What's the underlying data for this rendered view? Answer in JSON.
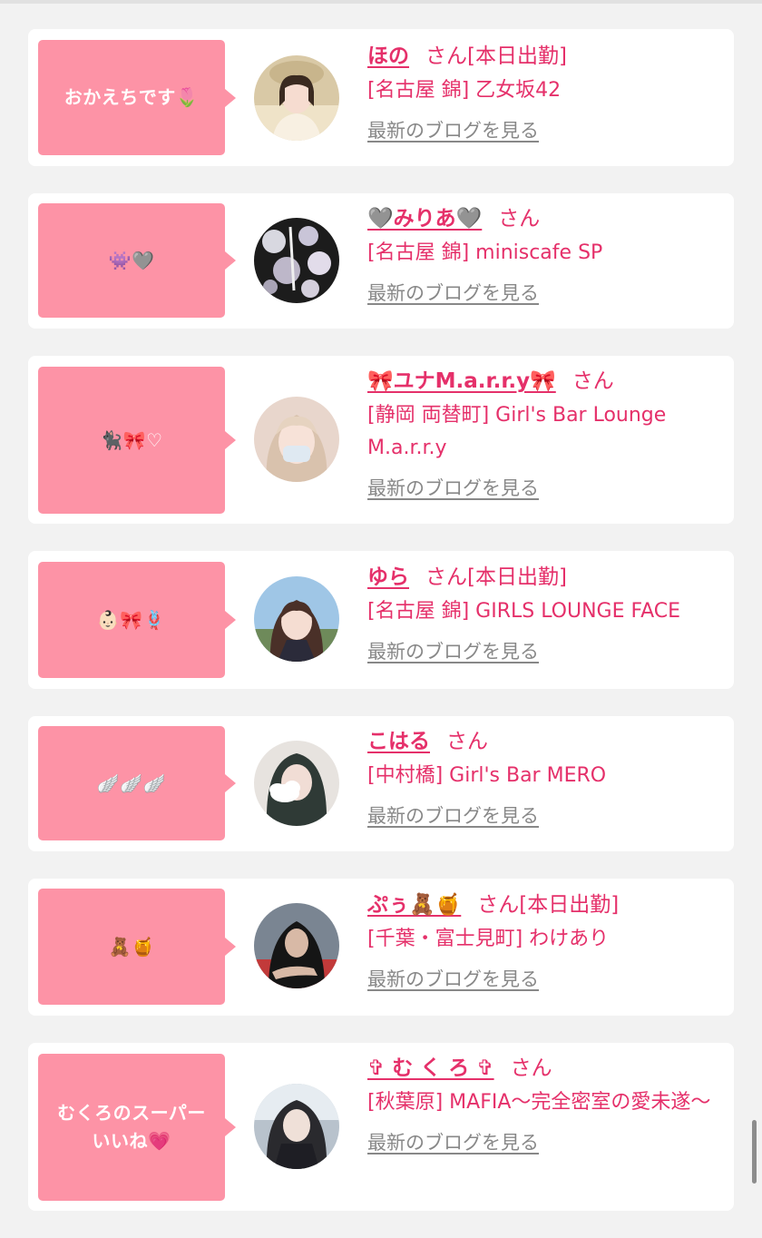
{
  "colors": {
    "accent": "#e5306a",
    "bubble": "#fd93a6",
    "link_gray": "#888888",
    "background": "#f2f2f2"
  },
  "cards": [
    {
      "message": "おかえちです🌷",
      "name": "ほの",
      "san": "さん",
      "tag": "[本日出勤]",
      "shop": "[名古屋 錦] 乙女坂42",
      "blog_link": "最新のブログを見る"
    },
    {
      "message": "👾🩶",
      "name": "🩶みりあ🩶",
      "san": "さん",
      "tag": "",
      "shop": "[名古屋 錦] miniscafe SP",
      "blog_link": "最新のブログを見る"
    },
    {
      "message": "🐈‍⬛🎀♡",
      "name": "🎀ユナM.a.r.r.y🎀",
      "san": "さん",
      "tag": "",
      "shop": "[静岡 両替町] Girl's Bar Lounge M.a.r.r.y",
      "blog_link": "最新のブログを見る"
    },
    {
      "message": "👶🏻🎀🪢",
      "name": "ゆら",
      "san": "さん",
      "tag": "[本日出勤]",
      "shop": "[名古屋 錦] GIRLS LOUNGE FACE",
      "blog_link": "最新のブログを見る"
    },
    {
      "message": "🪽🪽🪽",
      "name": "こはる",
      "san": "さん",
      "tag": "",
      "shop": "[中村橋] Girl's Bar MERO",
      "blog_link": "最新のブログを見る"
    },
    {
      "message": "🧸🍯",
      "name": "ぷぅ🧸🍯",
      "san": "さん",
      "tag": "[本日出勤]",
      "shop": "[千葉・富士見町] わけあり",
      "blog_link": "最新のブログを見る"
    },
    {
      "message": "むくろのスーパー\nいいね💗",
      "name": "✞ む く ろ ✞",
      "san": "さん",
      "tag": "",
      "shop": "[秋葉原] MAFIA～完全密室の愛未遂～",
      "blog_link": "最新のブログを見る"
    }
  ]
}
